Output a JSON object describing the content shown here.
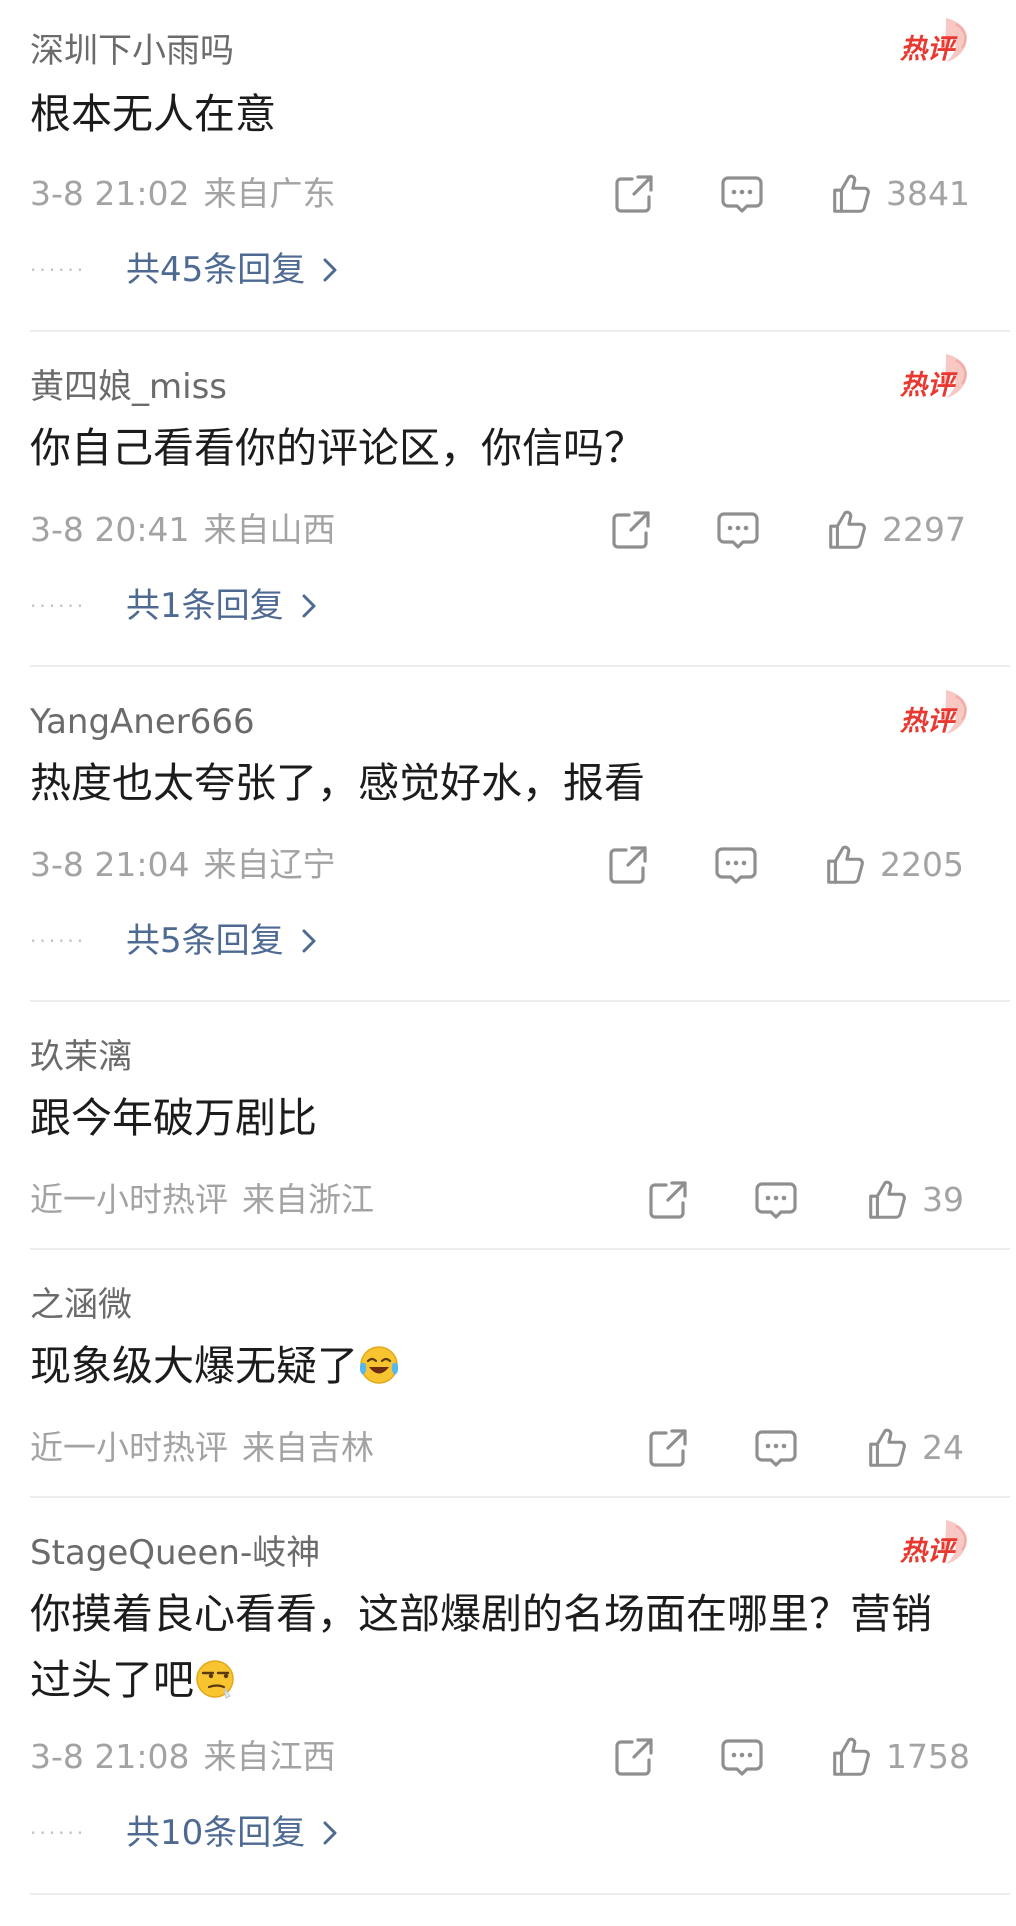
{
  "hot_badge_text": "热评",
  "colors": {
    "hot_badge": "#e8382f",
    "reply_link": "#4e6a93",
    "meta_text": "#a3a3a3",
    "username": "#6b6b6b",
    "separator": "#ececec"
  },
  "icons": {
    "share": "share-icon",
    "comment": "comment-icon",
    "like": "thumbs-up-icon",
    "reply_arrow": "chevron-right-icon",
    "hot": "hot-comment-badge-icon",
    "emoji_laugh_cry": "laughing-crying-emoji-icon",
    "emoji_smirk": "side-eye-emoji-icon"
  },
  "comments": [
    {
      "username": "深圳下小雨吗",
      "content": "根本无人在意",
      "time": "3-8 21:02",
      "location": "来自广东",
      "likes": "3841",
      "hot": true,
      "replies": "共45条回复"
    },
    {
      "username": "黄四娘_miss",
      "content": "你自己看看你的评论区，你信吗？",
      "time": "3-8 20:41",
      "location": "来自山西",
      "likes": "2297",
      "hot": true,
      "replies": "共1条回复"
    },
    {
      "username": "YangAner666",
      "content": "热度也太夸张了，感觉好水，报看",
      "time": "3-8 21:04",
      "location": "来自辽宁",
      "likes": "2205",
      "hot": true,
      "replies": "共5条回复"
    },
    {
      "username": "玖茉漓",
      "content": "跟今年破万剧比",
      "time": "近一小时热评",
      "location": "来自浙江",
      "likes": "39",
      "hot": false,
      "replies": ""
    },
    {
      "username": "之涵微",
      "content": "现象级大爆无疑了",
      "time": "近一小时热评",
      "location": "来自吉林",
      "likes": "24",
      "hot": false,
      "replies": ""
    },
    {
      "username": "StageQueen-岐神",
      "content": "你摸着良心看看，这部爆剧的名场面在哪里？营销",
      "content_line2": "过头了吧",
      "time": "3-8 21:08",
      "location": "来自江西",
      "likes": "1758",
      "hot": true,
      "replies": "共10条回复"
    }
  ]
}
